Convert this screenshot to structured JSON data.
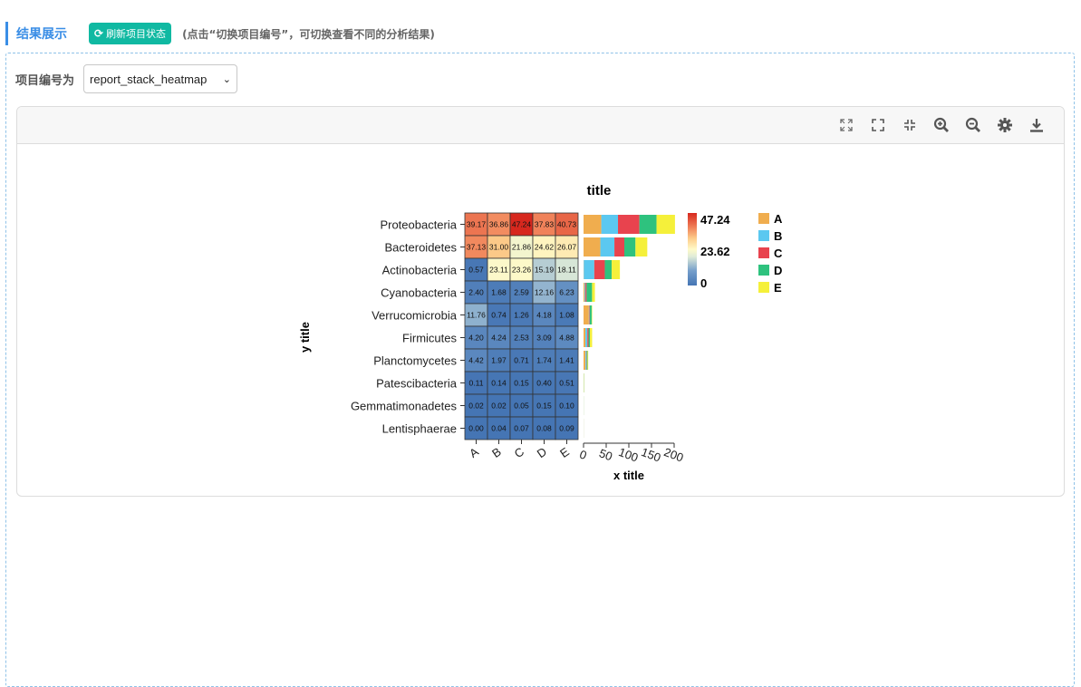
{
  "header": {
    "title": "结果展示",
    "refresh_label": "刷新项目状态",
    "hint": "(点击“切换项目编号”，可切换查看不同的分析结果)"
  },
  "project": {
    "label": "项目编号为",
    "selected": "report_stack_heatmap"
  },
  "toolbar": {
    "icons": [
      "expand-icon",
      "fullscreen-icon",
      "compress-icon",
      "zoom-in-icon",
      "zoom-out-icon",
      "gear-icon",
      "download-icon"
    ]
  },
  "chart_data": {
    "type": "heatmap",
    "title": "title",
    "xlabel": "x title",
    "ylabel": "y title",
    "rows": [
      "Proteobacteria",
      "Bacteroidetes",
      "Actinobacteria",
      "Cyanobacteria",
      "Verrucomicrobia",
      "Firmicutes",
      "Planctomycetes",
      "Patescibacteria",
      "Gemmatimonadetes",
      "Lentisphaerae"
    ],
    "columns": [
      "A",
      "B",
      "C",
      "D",
      "E"
    ],
    "values": [
      [
        39.17,
        36.86,
        47.24,
        37.83,
        40.73
      ],
      [
        37.13,
        31.0,
        21.86,
        24.62,
        26.07
      ],
      [
        0.57,
        23.11,
        23.26,
        15.19,
        18.11
      ],
      [
        2.4,
        1.68,
        2.59,
        12.16,
        6.23
      ],
      [
        11.76,
        0.74,
        1.26,
        4.18,
        1.08
      ],
      [
        4.2,
        4.24,
        2.53,
        3.09,
        4.88
      ],
      [
        4.42,
        1.97,
        0.71,
        1.74,
        1.41
      ],
      [
        0.11,
        0.14,
        0.15,
        0.4,
        0.51
      ],
      [
        0.02,
        0.02,
        0.05,
        0.15,
        0.1
      ],
      [
        0.0,
        0.04,
        0.07,
        0.08,
        0.09
      ]
    ],
    "colorbar": {
      "min": 0,
      "mid": 23.62,
      "max": 47.24,
      "labels": [
        "47.24",
        "23.62",
        "0"
      ]
    },
    "stack": {
      "type": "bar",
      "orientation": "horizontal",
      "xlim": [
        0,
        200
      ],
      "ticks": [
        "0",
        "50",
        "100",
        "150",
        "200"
      ],
      "series_colors": {
        "A": "#f0ad4e",
        "B": "#5bc8f0",
        "C": "#e8434e",
        "D": "#2ec27e",
        "E": "#f5f03a"
      }
    },
    "legend": [
      "A",
      "B",
      "C",
      "D",
      "E"
    ],
    "legend_position": "right"
  }
}
